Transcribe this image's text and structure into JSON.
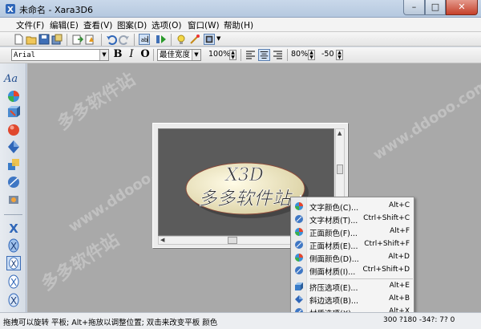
{
  "window": {
    "title": "未命名 - Xara3D6",
    "buttons": {
      "minimize": "–",
      "maximize": "□",
      "close": "✕"
    }
  },
  "menubar": {
    "items": [
      {
        "label": "文件(F)"
      },
      {
        "label": "编辑(E)"
      },
      {
        "label": "查看(V)"
      },
      {
        "label": "图案(D)"
      },
      {
        "label": "选项(O)"
      },
      {
        "label": "窗口(W)"
      },
      {
        "label": "帮助(H)"
      }
    ]
  },
  "toolbar1": {
    "icons": [
      "new-icon",
      "open-icon",
      "save-icon",
      "save-as-icon",
      "export-icon",
      "export-animation-icon",
      "undo-icon",
      "redo-icon",
      "text-edit-icon",
      "play-icon",
      "light-icon",
      "extrude-icon",
      "frame-options-icon"
    ]
  },
  "toolbar2": {
    "font_value": "Arial",
    "bold": "B",
    "italic": "I",
    "outline": "O",
    "width_mode": "最佳宽度",
    "char_spacing": "100%",
    "line_spacing": "80%",
    "kerning": "-50"
  },
  "sidebar": {
    "text_button": "Aa",
    "icons": [
      "text-button",
      "color-icon",
      "texture-icon",
      "sphere-icon",
      "extrude-icon",
      "bevel-icon",
      "shadow-icon",
      "animation-icon",
      "x-style-1-icon",
      "x-style-2-icon",
      "x-style-3-icon",
      "x-style-4-icon",
      "x-style-5-icon"
    ]
  },
  "canvas": {
    "line1": "X3D",
    "line2": "多多软件站",
    "watermark": "多多软件站 www.ddooo.com"
  },
  "context_menu": {
    "items": [
      {
        "label": "文字颜色(C)...",
        "shortcut": "Alt+C",
        "icon": "text-color-icon"
      },
      {
        "label": "文字材质(T)...",
        "shortcut": "Ctrl+Shift+C",
        "icon": "text-texture-icon"
      },
      {
        "label": "正面颜色(F)...",
        "shortcut": "Alt+F",
        "icon": "face-color-icon"
      },
      {
        "label": "正面材质(E)...",
        "shortcut": "Ctrl+Shift+F",
        "icon": "face-texture-icon"
      },
      {
        "label": "侧面颜色(D)...",
        "shortcut": "Alt+D",
        "icon": "side-color-icon"
      },
      {
        "label": "侧面材质(I)...",
        "shortcut": "Ctrl+Shift+D",
        "icon": "side-texture-icon"
      },
      {
        "label": "挤压选项(E)...",
        "shortcut": "Alt+E",
        "icon": "extrude-options-icon"
      },
      {
        "label": "斜边选项(B)...",
        "shortcut": "Alt+B",
        "icon": "bevel-options-icon"
      },
      {
        "label": "材质选项(X)...",
        "shortcut": "Alt+X",
        "icon": "texture-options-icon"
      }
    ]
  },
  "statusbar": {
    "message": "拖拽可以旋转 平板; Alt+拖放以调整位置; 双击来改变平板 颜色",
    "coords": "300 ?180  -34?: 7? 0"
  },
  "colors": {
    "accent": "#3a6bb5",
    "workspace": "#a9a9a9",
    "canvas_bg": "#5b5b5b",
    "text_face": "#f3ecc8",
    "close_button": "#c5402a"
  }
}
